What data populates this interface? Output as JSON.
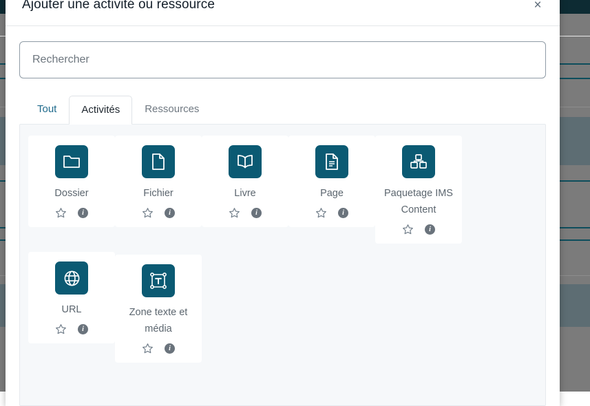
{
  "modal": {
    "title": "Ajouter une activité ou ressource",
    "close_label": "×",
    "close_icon": "close-icon"
  },
  "search": {
    "placeholder": "Rechercher",
    "value": ""
  },
  "tabs": [
    {
      "label": "Tout",
      "state": "link"
    },
    {
      "label": "Activités",
      "state": "active"
    },
    {
      "label": "Ressources",
      "state": "muted"
    }
  ],
  "cards": [
    {
      "label": "Dossier",
      "icon": "folder-icon",
      "star_icon": "star-outline-icon",
      "info_icon": "info-icon"
    },
    {
      "label": "Fichier",
      "icon": "file-icon",
      "star_icon": "star-outline-icon",
      "info_icon": "info-icon"
    },
    {
      "label": "Livre",
      "icon": "book-icon",
      "star_icon": "star-outline-icon",
      "info_icon": "info-icon"
    },
    {
      "label": "Page",
      "icon": "page-icon",
      "star_icon": "star-outline-icon",
      "info_icon": "info-icon"
    },
    {
      "label": "Paquetage IMS Content",
      "icon": "package-icon",
      "star_icon": "star-outline-icon",
      "info_icon": "info-icon"
    },
    {
      "label": "URL",
      "icon": "globe-icon",
      "star_icon": "star-outline-icon",
      "info_icon": "info-icon"
    },
    {
      "label": "Zone texte et média",
      "icon": "textbox-icon",
      "star_icon": "star-outline-icon",
      "info_icon": "info-icon"
    }
  ],
  "colors": {
    "icon_tile": "#0b5a73",
    "tab_link": "#1f6a8c",
    "backdrop_topbar": "#0d2b33",
    "backdrop_dim": "#7b7b7b"
  }
}
